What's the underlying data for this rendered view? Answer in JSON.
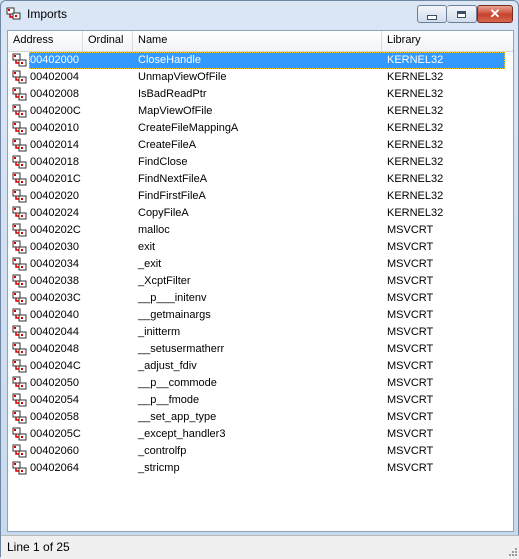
{
  "window": {
    "title": "Imports",
    "close_label": "✕"
  },
  "table": {
    "columns": {
      "address": "Address",
      "ordinal": "Ordinal",
      "name": "Name",
      "library": "Library"
    },
    "rows": [
      {
        "address": "00402000",
        "ordinal": "",
        "name": "CloseHandle",
        "library": "KERNEL32",
        "selected": true
      },
      {
        "address": "00402004",
        "ordinal": "",
        "name": "UnmapViewOfFile",
        "library": "KERNEL32"
      },
      {
        "address": "00402008",
        "ordinal": "",
        "name": "IsBadReadPtr",
        "library": "KERNEL32"
      },
      {
        "address": "0040200C",
        "ordinal": "",
        "name": "MapViewOfFile",
        "library": "KERNEL32"
      },
      {
        "address": "00402010",
        "ordinal": "",
        "name": "CreateFileMappingA",
        "library": "KERNEL32"
      },
      {
        "address": "00402014",
        "ordinal": "",
        "name": "CreateFileA",
        "library": "KERNEL32"
      },
      {
        "address": "00402018",
        "ordinal": "",
        "name": "FindClose",
        "library": "KERNEL32"
      },
      {
        "address": "0040201C",
        "ordinal": "",
        "name": "FindNextFileA",
        "library": "KERNEL32"
      },
      {
        "address": "00402020",
        "ordinal": "",
        "name": "FindFirstFileA",
        "library": "KERNEL32"
      },
      {
        "address": "00402024",
        "ordinal": "",
        "name": "CopyFileA",
        "library": "KERNEL32"
      },
      {
        "address": "0040202C",
        "ordinal": "",
        "name": "malloc",
        "library": "MSVCRT"
      },
      {
        "address": "00402030",
        "ordinal": "",
        "name": "exit",
        "library": "MSVCRT"
      },
      {
        "address": "00402034",
        "ordinal": "",
        "name": "_exit",
        "library": "MSVCRT"
      },
      {
        "address": "00402038",
        "ordinal": "",
        "name": "_XcptFilter",
        "library": "MSVCRT"
      },
      {
        "address": "0040203C",
        "ordinal": "",
        "name": "__p___initenv",
        "library": "MSVCRT"
      },
      {
        "address": "00402040",
        "ordinal": "",
        "name": "__getmainargs",
        "library": "MSVCRT"
      },
      {
        "address": "00402044",
        "ordinal": "",
        "name": "_initterm",
        "library": "MSVCRT"
      },
      {
        "address": "00402048",
        "ordinal": "",
        "name": "__setusermatherr",
        "library": "MSVCRT"
      },
      {
        "address": "0040204C",
        "ordinal": "",
        "name": "_adjust_fdiv",
        "library": "MSVCRT"
      },
      {
        "address": "00402050",
        "ordinal": "",
        "name": "__p__commode",
        "library": "MSVCRT"
      },
      {
        "address": "00402054",
        "ordinal": "",
        "name": "__p__fmode",
        "library": "MSVCRT"
      },
      {
        "address": "00402058",
        "ordinal": "",
        "name": "__set_app_type",
        "library": "MSVCRT"
      },
      {
        "address": "0040205C",
        "ordinal": "",
        "name": "_except_handler3",
        "library": "MSVCRT"
      },
      {
        "address": "00402060",
        "ordinal": "",
        "name": "_controlfp",
        "library": "MSVCRT"
      },
      {
        "address": "00402064",
        "ordinal": "",
        "name": "_stricmp",
        "library": "MSVCRT"
      }
    ]
  },
  "status": {
    "text": "Line 1 of 25"
  },
  "colors": {
    "selection": "#3399ff",
    "focus_border": "#ffd000",
    "close_button": "#c7432c"
  },
  "icons": {
    "app": "imports-icon",
    "row": "import-entry-icon"
  }
}
